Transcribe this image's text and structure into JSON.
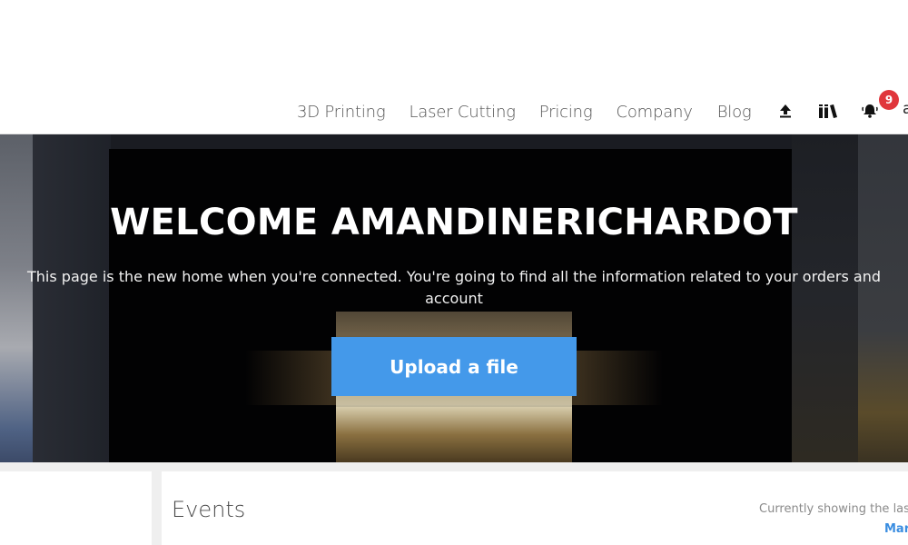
{
  "nav": {
    "links": [
      {
        "label": "3D Printing"
      },
      {
        "label": "Laser Cutting"
      },
      {
        "label": "Pricing"
      },
      {
        "label": "Company"
      },
      {
        "label": "Blog"
      }
    ],
    "icons": {
      "upload": "upload-icon",
      "library": "library-icon",
      "notifications": "bell-icon"
    },
    "notification_count": "9",
    "user_initial": "a",
    "badge_color": "#e0363c"
  },
  "hero": {
    "title": "WELCOME AMANDINERICHARDOT",
    "subtitle": "This page is the new home when you're connected. You're going to find all the information related to your orders and account",
    "upload_button_label": "Upload a file",
    "button_color": "#4499ea"
  },
  "events": {
    "title": "Events",
    "status_text": "Currently showing the las",
    "link_text": "Mar",
    "link_color": "#3a8de0"
  }
}
